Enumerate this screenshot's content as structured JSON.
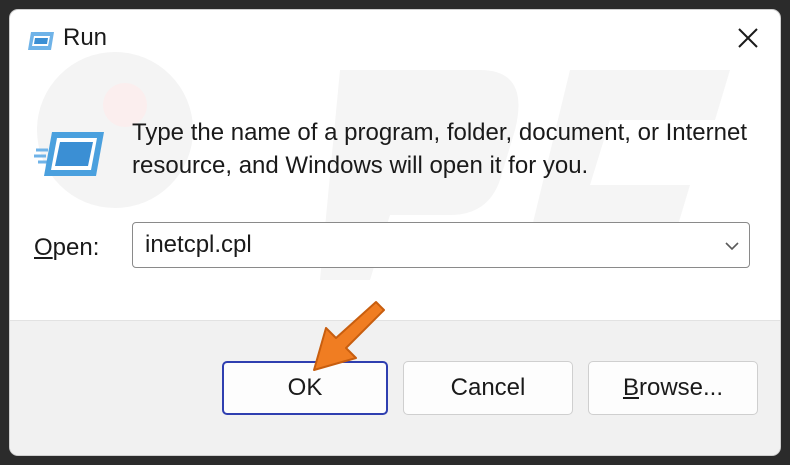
{
  "window": {
    "title": "Run",
    "close_icon": "close-icon",
    "app_icon": "run-app-icon"
  },
  "message": "Type the name of a program, folder, document, or Internet resource, and Windows will open it for you.",
  "open_field": {
    "label_accel": "O",
    "label_rest": "pen:",
    "value": "inetcpl.cpl",
    "caret_icon": "chevron-down-icon"
  },
  "buttons": {
    "ok": "OK",
    "cancel": "Cancel",
    "browse_accel": "B",
    "browse_rest": "rowse..."
  },
  "colors": {
    "accent_border": "#2f3fb0",
    "arrow": "#f07d22",
    "icon_blue": "#3b8fd4"
  }
}
